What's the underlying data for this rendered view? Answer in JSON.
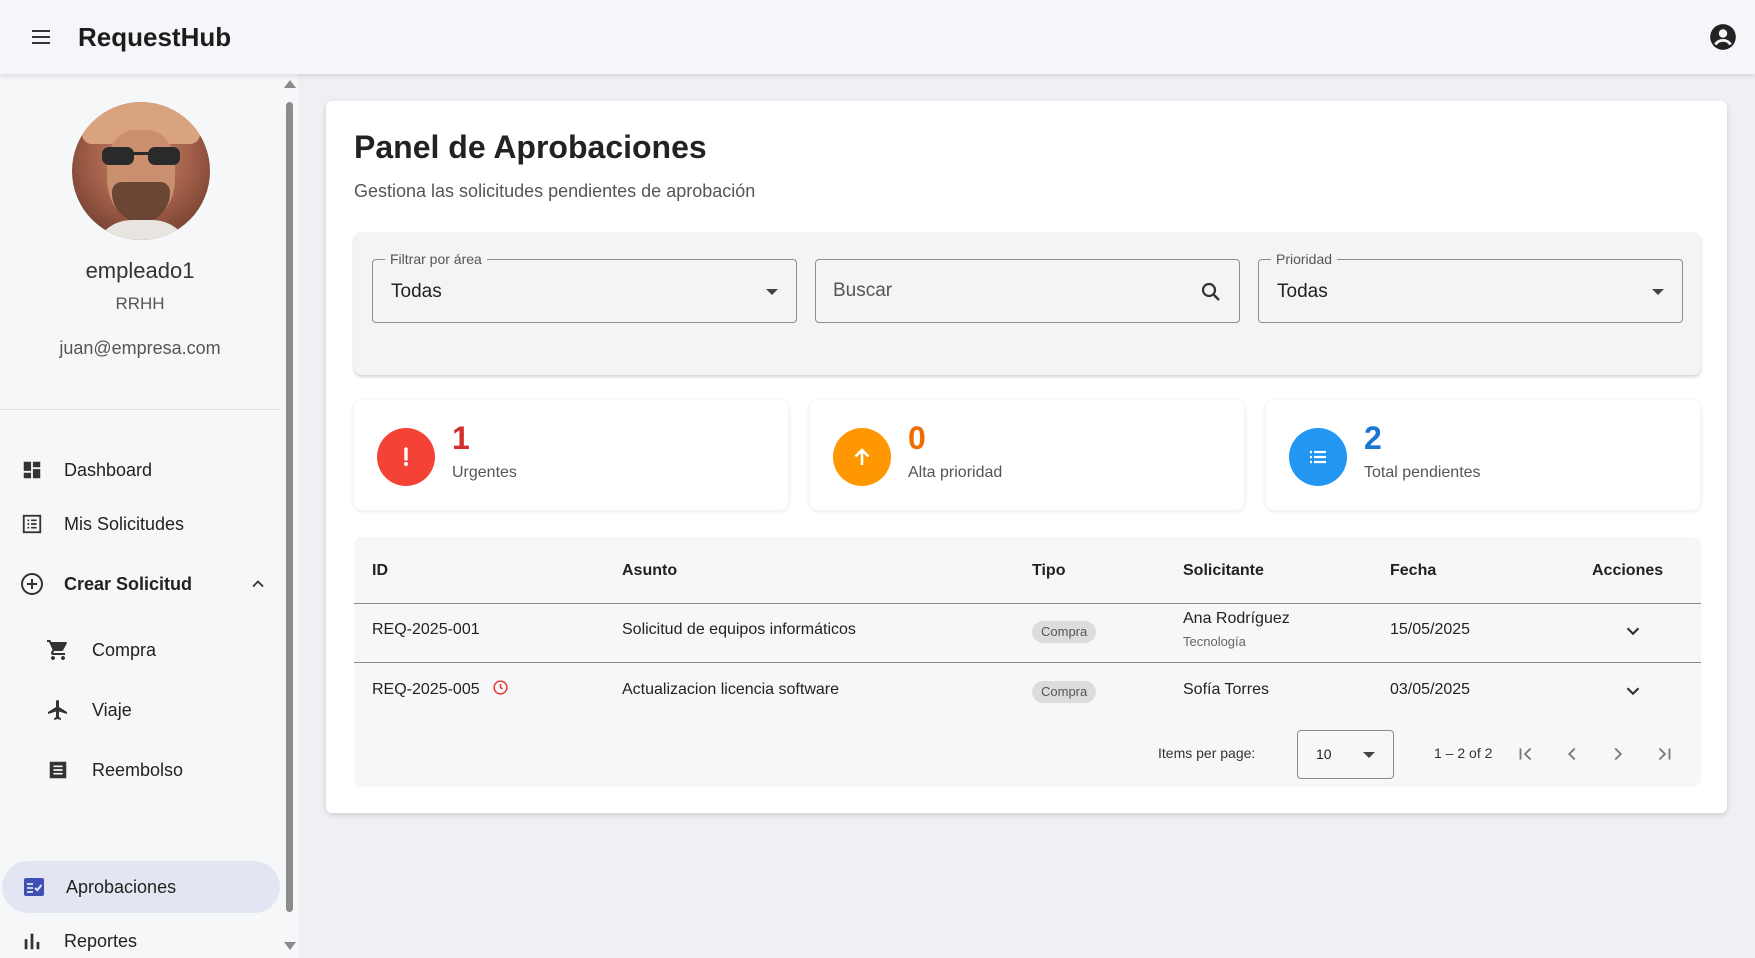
{
  "app": {
    "title": "RequestHub"
  },
  "user": {
    "name": "empleado1",
    "department": "RRHH",
    "email": "juan@empresa.com"
  },
  "sidebar": {
    "items": [
      {
        "label": "Dashboard",
        "icon": "dashboard-icon"
      },
      {
        "label": "Mis Solicitudes",
        "icon": "list-alt-icon"
      },
      {
        "label": "Crear Solicitud",
        "icon": "add-circle-icon",
        "expanded": true
      },
      {
        "label": "Compra",
        "icon": "cart-icon"
      },
      {
        "label": "Viaje",
        "icon": "airplane-icon"
      },
      {
        "label": "Reembolso",
        "icon": "receipt-icon"
      },
      {
        "label": "Aprobaciones",
        "icon": "approval-icon",
        "active": true
      },
      {
        "label": "Reportes",
        "icon": "bar-chart-icon"
      }
    ]
  },
  "page": {
    "title": "Panel de Aprobaciones",
    "subtitle": "Gestiona las solicitudes pendientes de aprobación"
  },
  "filters": {
    "area": {
      "label": "Filtrar por área",
      "value": "Todas"
    },
    "search": {
      "placeholder": "Buscar"
    },
    "priority": {
      "label": "Prioridad",
      "value": "Todas"
    }
  },
  "stats": [
    {
      "value": "1",
      "label": "Urgentes",
      "color": "#f44336",
      "text_color": "#d32f2f",
      "icon": "exclamation-icon"
    },
    {
      "value": "0",
      "label": "Alta prioridad",
      "color": "#ff9800",
      "text_color": "#ef6c00",
      "icon": "arrow-up-icon"
    },
    {
      "value": "2",
      "label": "Total pendientes",
      "color": "#2196f3",
      "text_color": "#1976d2",
      "icon": "list-icon"
    }
  ],
  "table": {
    "columns": [
      "ID",
      "Asunto",
      "Tipo",
      "Solicitante",
      "Fecha",
      "Acciones"
    ],
    "rows": [
      {
        "id": "REQ-2025-001",
        "subject": "Solicitud de equipos informáticos",
        "type": "Compra",
        "requester": "Ana Rodríguez",
        "requester_area": "Tecnología",
        "date": "15/05/2025",
        "overdue": false
      },
      {
        "id": "REQ-2025-005",
        "subject": "Actualizacion licencia software",
        "type": "Compra",
        "requester": "Sofía Torres",
        "requester_area": "",
        "date": "03/05/2025",
        "overdue": true
      }
    ]
  },
  "paginator": {
    "items_label": "Items per page:",
    "page_size": "10",
    "range": "1 – 2 of 2"
  }
}
